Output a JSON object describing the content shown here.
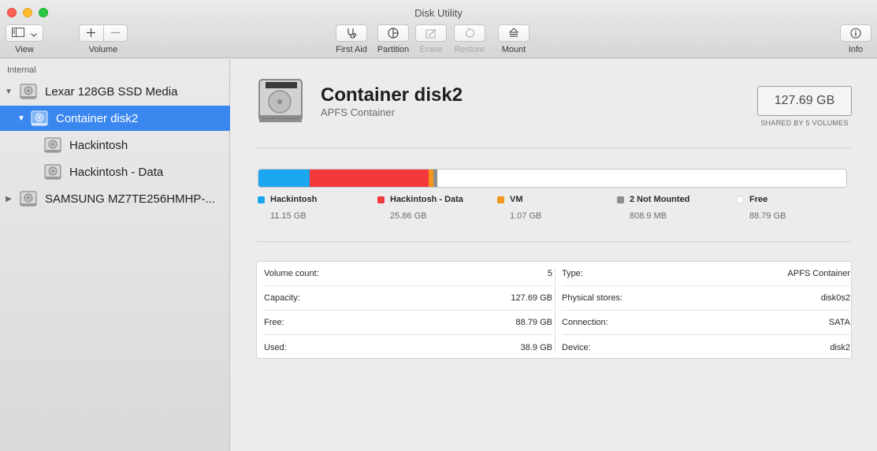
{
  "window": {
    "title": "Disk Utility"
  },
  "toolbar": {
    "view_label": "View",
    "volume_label": "Volume",
    "first_aid_label": "First Aid",
    "partition_label": "Partition",
    "erase_label": "Erase",
    "restore_label": "Restore",
    "mount_label": "Mount",
    "info_label": "Info",
    "icons": [
      "sidebar-icon",
      "chevron-down-icon",
      "plus-icon",
      "minus-icon",
      "stethoscope-icon",
      "pie-chart-icon",
      "eraser-icon",
      "restore-icon",
      "eject-icon",
      "info-icon"
    ]
  },
  "sidebar": {
    "heading": "Internal",
    "items": [
      {
        "label": "Lexar 128GB SSD Media",
        "level": 0,
        "expanded": true,
        "selected": false
      },
      {
        "label": "Container disk2",
        "level": 1,
        "expanded": true,
        "selected": true
      },
      {
        "label": "Hackintosh",
        "level": 2,
        "selected": false
      },
      {
        "label": "Hackintosh - Data",
        "level": 2,
        "selected": false
      },
      {
        "label": "SAMSUNG MZ7TE256HMHP-...",
        "level": 0,
        "expanded": false,
        "selected": false
      }
    ]
  },
  "detail": {
    "name": "Container disk2",
    "subtitle": "APFS Container",
    "size": "127.69 GB",
    "shared": "SHARED BY 5 VOLUMES"
  },
  "usage": {
    "segments": [
      {
        "name": "Hackintosh",
        "size": "11.15 GB",
        "fraction": 0.0873,
        "color": "#1ba7f0"
      },
      {
        "name": "Hackintosh - Data",
        "size": "25.86 GB",
        "fraction": 0.2025,
        "color": "#f3393b"
      },
      {
        "name": "VM",
        "size": "1.07 GB",
        "fraction": 0.0084,
        "color": "#f5971d"
      },
      {
        "name": "2 Not Mounted",
        "size": "808.9 MB",
        "fraction": 0.0063,
        "color": "#8e8e8e"
      },
      {
        "name": "Free",
        "size": "88.79 GB",
        "fraction": 0.6954,
        "color": "#ffffff"
      }
    ]
  },
  "info": {
    "left": [
      {
        "key": "Volume count:",
        "value": "5"
      },
      {
        "key": "Capacity:",
        "value": "127.69 GB"
      },
      {
        "key": "Free:",
        "value": "88.79 GB"
      },
      {
        "key": "Used:",
        "value": "38.9 GB"
      }
    ],
    "right": [
      {
        "key": "Type:",
        "value": "APFS Container"
      },
      {
        "key": "Physical stores:",
        "value": "disk0s2"
      },
      {
        "key": "Connection:",
        "value": "SATA"
      },
      {
        "key": "Device:",
        "value": "disk2"
      }
    ]
  }
}
